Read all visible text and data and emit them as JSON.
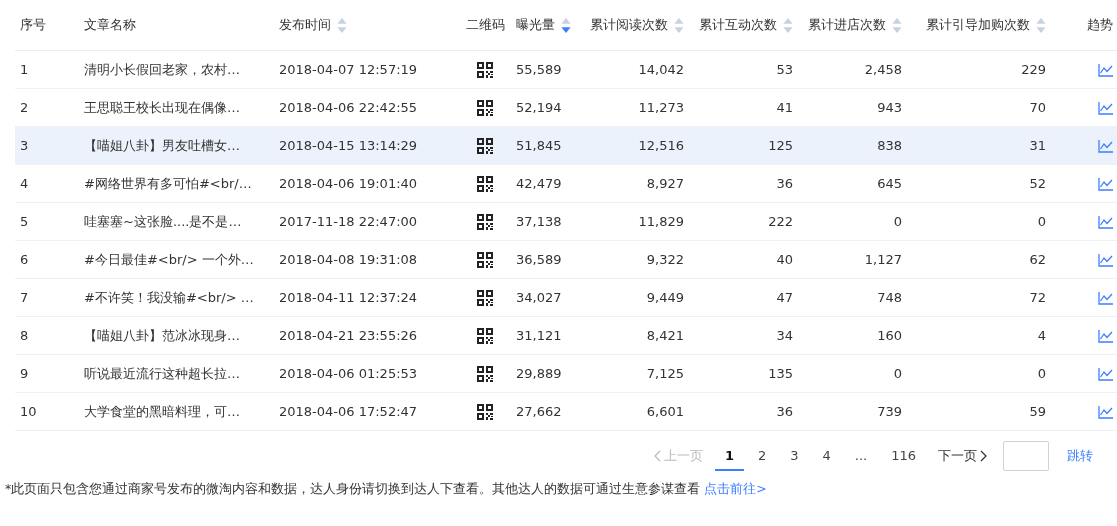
{
  "table": {
    "columns": [
      {
        "label": "序号",
        "sortable": false
      },
      {
        "label": "文章名称",
        "sortable": false
      },
      {
        "label": "发布时间",
        "sortable": true,
        "sorted_desc": false
      },
      {
        "label": "二维码",
        "sortable": false
      },
      {
        "label": "曝光量",
        "sortable": true,
        "sorted_desc": true
      },
      {
        "label": "累计阅读次数",
        "sortable": true,
        "sorted_desc": false
      },
      {
        "label": "累计互动次数",
        "sortable": true,
        "sorted_desc": false
      },
      {
        "label": "累计进店次数",
        "sortable": true,
        "sorted_desc": false
      },
      {
        "label": "累计引导加购次数",
        "sortable": true,
        "sorted_desc": false
      },
      {
        "label": "趋势",
        "sortable": false
      }
    ],
    "rows": [
      {
        "index": "1",
        "title": "清明小长假回老家，农村…",
        "time": "2018-04-07 12:57:19",
        "exposure": "55,589",
        "reads": "14,042",
        "interactions": "53",
        "store_visits": "2,458",
        "cart_adds": "229",
        "highlighted": false
      },
      {
        "index": "2",
        "title": "王思聪王校长出现在偶像…",
        "time": "2018-04-06 22:42:55",
        "exposure": "52,194",
        "reads": "11,273",
        "interactions": "41",
        "store_visits": "943",
        "cart_adds": "70",
        "highlighted": false
      },
      {
        "index": "3",
        "title": "【喵姐八卦】男友吐槽女…",
        "time": "2018-04-15 13:14:29",
        "exposure": "51,845",
        "reads": "12,516",
        "interactions": "125",
        "store_visits": "838",
        "cart_adds": "31",
        "highlighted": true
      },
      {
        "index": "4",
        "title": "#网络世界有多可怕#<br/…",
        "time": "2018-04-06 19:01:40",
        "exposure": "42,479",
        "reads": "8,927",
        "interactions": "36",
        "store_visits": "645",
        "cart_adds": "52",
        "highlighted": false
      },
      {
        "index": "5",
        "title": "哇塞塞~这张脸....是不是…",
        "time": "2017-11-18 22:47:00",
        "exposure": "37,138",
        "reads": "11,829",
        "interactions": "222",
        "store_visits": "0",
        "cart_adds": "0",
        "highlighted": false
      },
      {
        "index": "6",
        "title": "#今日最佳#<br/> 一个外…",
        "time": "2018-04-08 19:31:08",
        "exposure": "36,589",
        "reads": "9,322",
        "interactions": "40",
        "store_visits": "1,127",
        "cart_adds": "62",
        "highlighted": false
      },
      {
        "index": "7",
        "title": "#不许笑！我没输#<br/> …",
        "time": "2018-04-11 12:37:24",
        "exposure": "34,027",
        "reads": "9,449",
        "interactions": "47",
        "store_visits": "748",
        "cart_adds": "72",
        "highlighted": false
      },
      {
        "index": "8",
        "title": "【喵姐八卦】范冰冰现身…",
        "time": "2018-04-21 23:55:26",
        "exposure": "31,121",
        "reads": "8,421",
        "interactions": "34",
        "store_visits": "160",
        "cart_adds": "4",
        "highlighted": false
      },
      {
        "index": "9",
        "title": "听说最近流行这种超长拉…",
        "time": "2018-04-06 01:25:53",
        "exposure": "29,889",
        "reads": "7,125",
        "interactions": "135",
        "store_visits": "0",
        "cart_adds": "0",
        "highlighted": false
      },
      {
        "index": "10",
        "title": "大学食堂的黑暗料理，可…",
        "time": "2018-04-06 17:52:47",
        "exposure": "27,662",
        "reads": "6,601",
        "interactions": "36",
        "store_visits": "739",
        "cart_adds": "59",
        "highlighted": false
      }
    ]
  },
  "pagination": {
    "prev": {
      "label": "上一页",
      "disabled": true
    },
    "pages": [
      {
        "label": "1",
        "kind": "page",
        "selected": true
      },
      {
        "label": "2",
        "kind": "page",
        "selected": false
      },
      {
        "label": "3",
        "kind": "page",
        "selected": false
      },
      {
        "label": "4",
        "kind": "page",
        "selected": false
      },
      {
        "label": "...",
        "kind": "ellipsis"
      },
      {
        "label": "116",
        "kind": "page",
        "selected": false
      }
    ],
    "next": {
      "label": "下一页",
      "disabled": false
    },
    "jump_label": "跳转"
  },
  "footnote": {
    "text": "*此页面只包含您通过商家号发布的微淘内容和数据，达人身份请切换到达人下查看。其他达人的数据可通过生意参谋查看 ",
    "link": "点击前往>"
  }
}
